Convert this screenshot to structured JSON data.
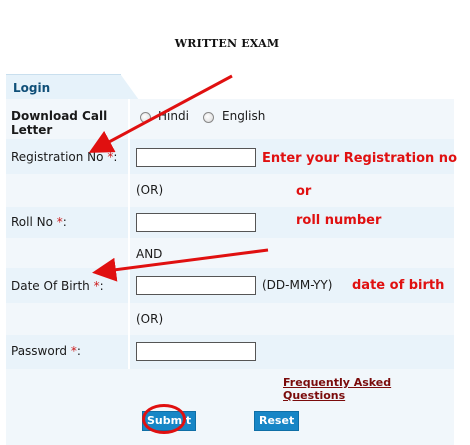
{
  "page_title": "WRITTEN EXAM",
  "tab": {
    "label": "Login"
  },
  "form": {
    "download_call_letter": "Download Call Letter",
    "lang_hindi": "Hindi",
    "lang_english": "English",
    "registration_no": "Registration No",
    "or_1": "(OR)",
    "roll_no": "Roll No",
    "and": "AND",
    "date_of_birth": "Date Of Birth",
    "dob_format": "(DD-MM-YY)",
    "or_2": "(OR)",
    "password": "Password",
    "required_mark": "*",
    "colon": ":",
    "faq": "Frequently Asked Questions",
    "submit": "Submit",
    "reset": "Reset"
  },
  "annotations": {
    "enter_registration": "Enter your Registration no",
    "or": "or",
    "roll_number": "roll number",
    "date_of_birth": "date of birth"
  },
  "colors": {
    "accent": "#1786c6",
    "annotation": "#e01010",
    "faq_link": "#7a0b0b",
    "required": "#cc1a1a"
  }
}
